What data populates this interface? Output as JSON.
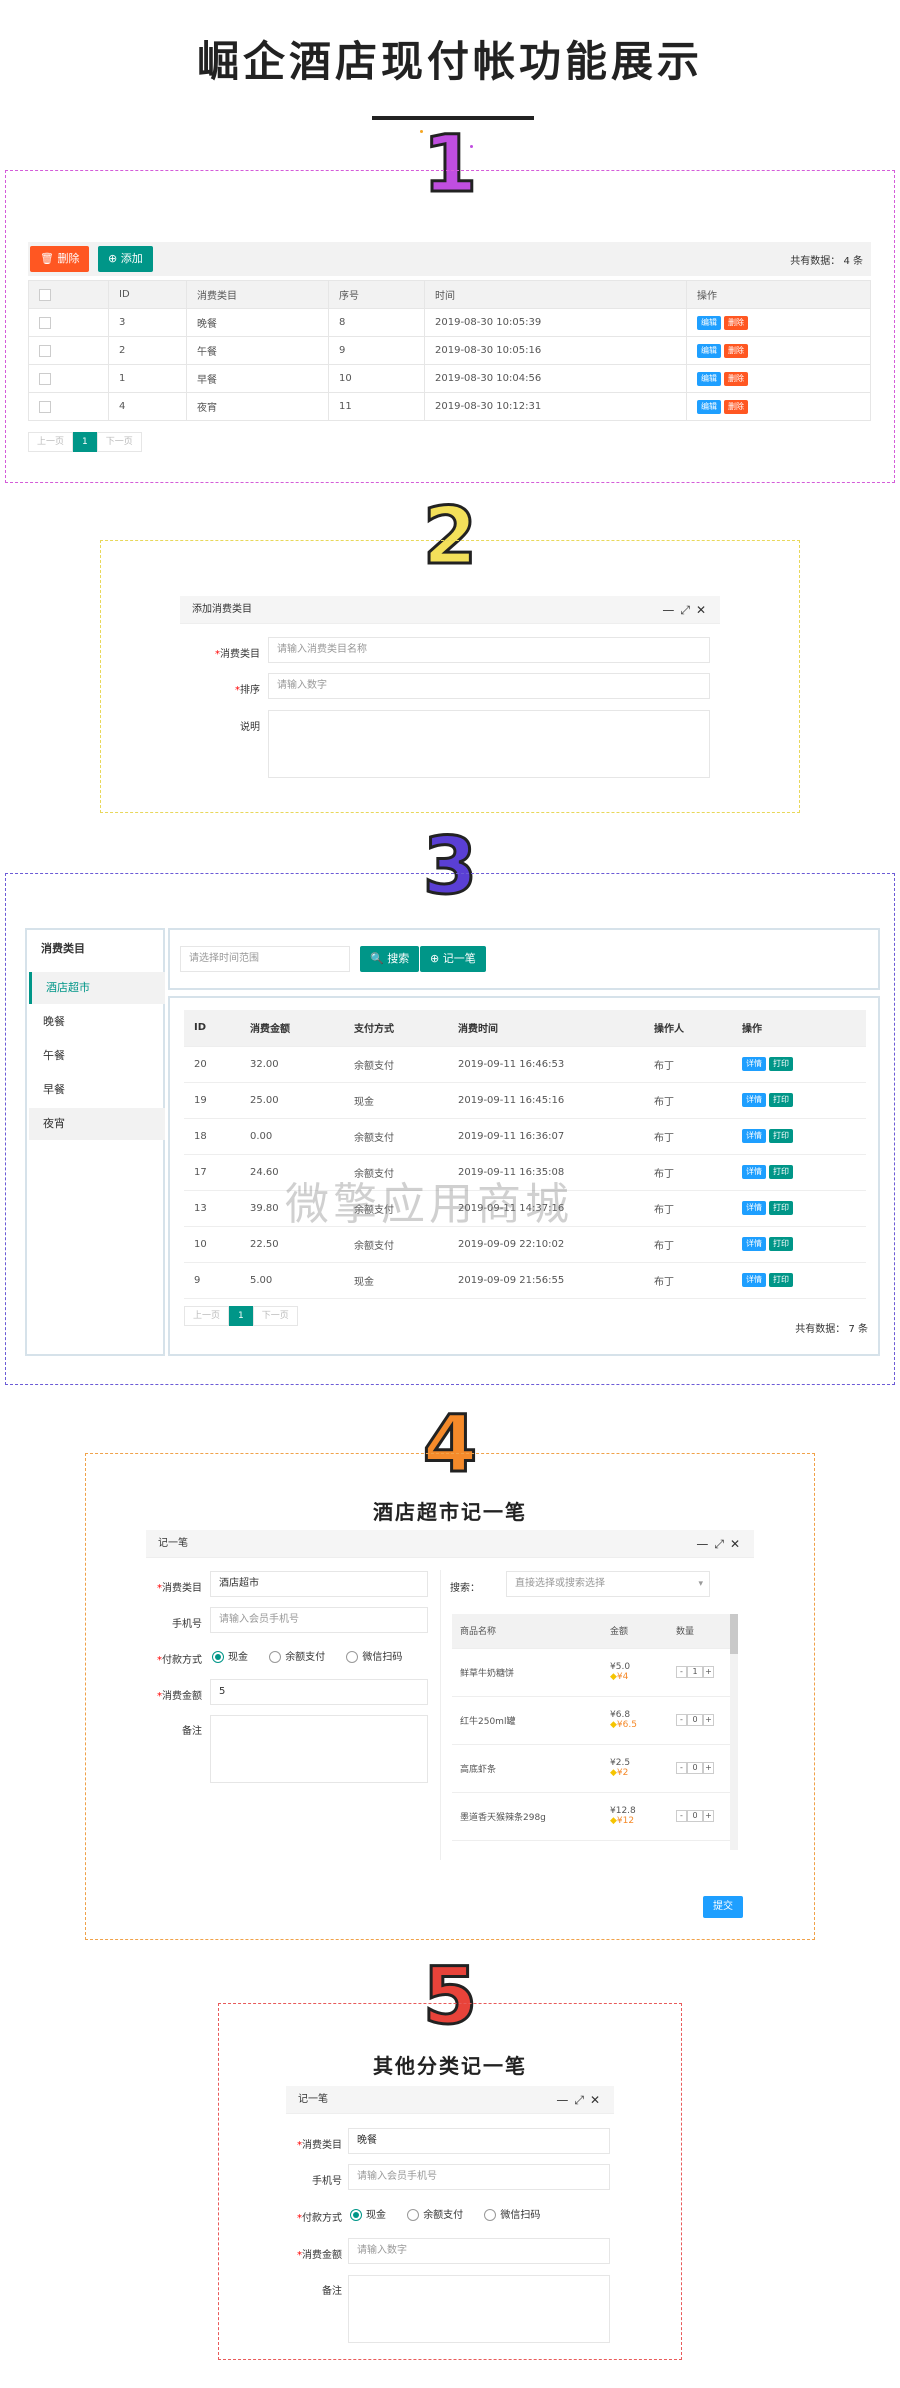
{
  "header": {
    "title": "崛企酒店现付帐功能展示"
  },
  "colors": {
    "green": "#009688",
    "red": "#ff5722",
    "blue": "#1e9fff"
  },
  "sections": [
    "1",
    "2",
    "3",
    "4",
    "5"
  ],
  "s1": {
    "delete_label": "删除",
    "add_label": "添加",
    "total": "共有数据： 4 条",
    "columns": [
      "ID",
      "消费类目",
      "序号",
      "时间",
      "操作"
    ],
    "rows": [
      {
        "id": "3",
        "name": "晚餐",
        "order": "8",
        "time": "2019-08-30 10:05:39"
      },
      {
        "id": "2",
        "name": "午餐",
        "order": "9",
        "time": "2019-08-30 10:05:16"
      },
      {
        "id": "1",
        "name": "早餐",
        "order": "10",
        "time": "2019-08-30 10:04:56"
      },
      {
        "id": "4",
        "name": "夜宵",
        "order": "11",
        "time": "2019-08-30 10:12:31"
      }
    ],
    "edit": "编辑",
    "del": "删除",
    "pager": {
      "prev": "上一页",
      "cur": "1",
      "next": "下一页"
    }
  },
  "s2": {
    "dialog_title": "添加消费类目",
    "f1_label": "消费类目",
    "f1_ph": "请输入消费类目名称",
    "f2_label": "排序",
    "f2_ph": "请输入数字",
    "f3_label": "说明"
  },
  "s3": {
    "sidebar": {
      "title": "消费类目",
      "items": [
        "酒店超市",
        "晚餐",
        "午餐",
        "早餐",
        "夜宵"
      ]
    },
    "search_ph": "请选择时间范围",
    "search_btn": "搜索",
    "add_btn": "记一笔",
    "columns": [
      "ID",
      "消费金额",
      "支付方式",
      "消费时间",
      "操作人",
      "操作"
    ],
    "rows": [
      {
        "id": "20",
        "amt": "32.00",
        "pay": "余额支付",
        "time": "2019-09-11 16:46:53",
        "op": "布丁"
      },
      {
        "id": "19",
        "amt": "25.00",
        "pay": "现金",
        "time": "2019-09-11 16:45:16",
        "op": "布丁"
      },
      {
        "id": "18",
        "amt": "0.00",
        "pay": "余额支付",
        "time": "2019-09-11 16:36:07",
        "op": "布丁"
      },
      {
        "id": "17",
        "amt": "24.60",
        "pay": "余额支付",
        "time": "2019-09-11 16:35:08",
        "op": "布丁"
      },
      {
        "id": "13",
        "amt": "39.80",
        "pay": "余额支付",
        "time": "2019-09-11 14:37:16",
        "op": "布丁"
      },
      {
        "id": "10",
        "amt": "22.50",
        "pay": "余额支付",
        "time": "2019-09-09 22:10:02",
        "op": "布丁"
      },
      {
        "id": "9",
        "amt": "5.00",
        "pay": "现金",
        "time": "2019-09-09 21:56:55",
        "op": "布丁"
      }
    ],
    "detail": "详情",
    "print": "打印",
    "pager": {
      "prev": "上一页",
      "cur": "1",
      "next": "下一页"
    },
    "total": "共有数据： 7 条",
    "watermark": "微擎应用商城"
  },
  "s4": {
    "heading": "酒店超市记一笔",
    "dialog_title": "记一笔",
    "cat_label": "消费类目",
    "cat_val": "酒店超市",
    "phone_label": "手机号",
    "phone_ph": "请输入会员手机号",
    "pay_label": "付款方式",
    "pay_opts": [
      "现金",
      "余额支付",
      "微信扫码"
    ],
    "amt_label": "消费金额",
    "amt_val": "5",
    "note_label": "备注",
    "search_label": "搜索：",
    "search_ph": "直接选择或搜索选择",
    "columns": [
      "商品名称",
      "金额",
      "数量"
    ],
    "goods": [
      {
        "name": "鲜草牛奶糖饼",
        "price": "¥5.0",
        "vip": "¥4",
        "qty": "1"
      },
      {
        "name": "红牛250ml罐",
        "price": "¥6.8",
        "vip": "¥6.5",
        "qty": "0"
      },
      {
        "name": "高底虾条",
        "price": "¥2.5",
        "vip": "¥2",
        "qty": "0"
      },
      {
        "name": "墨道香天猴辣条298g",
        "price": "¥12.8",
        "vip": "¥12",
        "qty": "0"
      }
    ],
    "submit": "提交"
  },
  "s5": {
    "heading": "其他分类记一笔",
    "dialog_title": "记一笔",
    "cat_label": "消费类目",
    "cat_val": "晚餐",
    "phone_label": "手机号",
    "phone_ph": "请输入会员手机号",
    "pay_label": "付款方式",
    "pay_opts": [
      "现金",
      "余额支付",
      "微信扫码"
    ],
    "amt_label": "消费金额",
    "amt_ph": "请输入数字",
    "note_label": "备注"
  }
}
